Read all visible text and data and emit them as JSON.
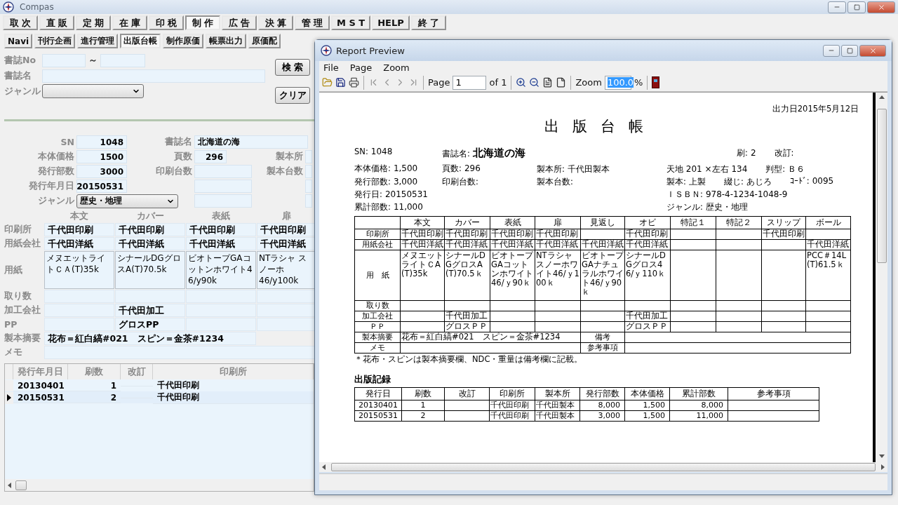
{
  "app": {
    "title": "Compas"
  },
  "main_menu": [
    {
      "label": "取 次",
      "selected": false
    },
    {
      "label": "直 販",
      "selected": false
    },
    {
      "label": "定 期",
      "selected": false
    },
    {
      "label": "在 庫",
      "selected": false
    },
    {
      "label": "印 税",
      "selected": false
    },
    {
      "label": "制 作",
      "selected": true
    },
    {
      "label": "広 告",
      "selected": false
    },
    {
      "label": "決 算",
      "selected": false
    },
    {
      "label": "管 理",
      "selected": false
    },
    {
      "label": "M S T",
      "selected": false
    },
    {
      "label": "HELP",
      "selected": false
    },
    {
      "label": "終 了",
      "selected": false
    }
  ],
  "tabs": [
    {
      "label": "Navi",
      "selected": false
    },
    {
      "label": "刊行企画",
      "selected": false
    },
    {
      "label": "進行管理",
      "selected": false
    },
    {
      "label": "出版台帳",
      "selected": true
    },
    {
      "label": "制作原価",
      "selected": false
    },
    {
      "label": "帳票出力",
      "selected": false
    },
    {
      "label": "原価配",
      "selected": false
    }
  ],
  "search": {
    "no_label": "書誌No",
    "range_separator": "～",
    "title_label": "書誌名",
    "genre_label": "ジャンル",
    "buttons": [
      "検 索",
      "クリア"
    ]
  },
  "details": [
    {
      "cells": [
        {
          "label": "SN",
          "value": "1048",
          "kind": "number"
        },
        {
          "label": "書誌名",
          "value": "北海道の海",
          "kind": "wide"
        }
      ]
    },
    {
      "cells": [
        {
          "label": "本体価格",
          "value": "1500",
          "kind": "number"
        },
        {
          "label": "頁数",
          "value": "296",
          "kind": "short"
        },
        {
          "label": "製本所",
          "kind": "stub"
        }
      ]
    },
    {
      "cells": [
        {
          "label": "発行部数",
          "value": "3000",
          "kind": "number"
        },
        {
          "label": "印刷台数",
          "kind": "field"
        },
        {
          "label": "製本台数",
          "kind": "stub"
        }
      ]
    },
    {
      "cells": [
        {
          "label": "発行年月日",
          "value": "20150531",
          "kind": "number"
        },
        {
          "kind": "field"
        },
        {
          "kind": "stub"
        }
      ]
    },
    {
      "cells": [
        {
          "label": "ジャンル",
          "value": "歴史・地理",
          "kind": "select"
        },
        {
          "kind": "field"
        },
        {
          "kind": "stub"
        }
      ]
    }
  ],
  "materials": {
    "columns": [
      "本文",
      "カバー",
      "表紙",
      "扉"
    ],
    "rows": [
      {
        "label": "印刷所",
        "kind": "line",
        "cells": [
          "千代田印刷",
          "千代田印刷",
          "千代田印刷",
          "千代田印刷"
        ]
      },
      {
        "label": "用紙会社",
        "kind": "line",
        "cells": [
          "千代田洋紙",
          "千代田洋紙",
          "千代田洋紙",
          "千代田洋紙"
        ]
      },
      {
        "label": "用紙",
        "kind": "tall",
        "cells": [
          "メヌエットライトＣＡ(T)35k",
          "シナールDGグロスA(T)70.5k",
          "ビオトープGAコットンホワイト46/y90k",
          "NTラシャ スノーホ\n46/y100k"
        ]
      },
      {
        "label": "取り数",
        "kind": "line",
        "cells": [
          "",
          "",
          "",
          ""
        ]
      },
      {
        "label": "加工会社",
        "kind": "line",
        "cells": [
          "",
          "千代田加工",
          "",
          ""
        ]
      },
      {
        "label": "PP",
        "kind": "line",
        "cells": [
          "",
          "グロスPP",
          "",
          ""
        ]
      }
    ],
    "binding_label": "製本摘要",
    "binding_value": "花布＝紅白縞#021　スピン＝金茶#1234",
    "memo_label": "メモ"
  },
  "history": {
    "columns": [
      "発行年月日",
      "刷数",
      "改訂",
      "印刷所"
    ],
    "rows": [
      {
        "date": "20130401",
        "printing": "1",
        "revision": "",
        "printer": "千代田印刷",
        "selected": false
      },
      {
        "date": "20150531",
        "printing": "2",
        "revision": "",
        "printer": "千代田印刷",
        "selected": true
      }
    ]
  },
  "report": {
    "title": "Report Preview",
    "menu": [
      "File",
      "Page",
      "Zoom"
    ],
    "toolbar": {
      "page_label": "Page",
      "page_value": "1",
      "page_of": "of 1",
      "zoom_label": "Zoom",
      "zoom_value": "100.0",
      "percent": "%"
    },
    "page": {
      "date": "出力日2015年5月12日",
      "heading": "出 版 台 帳",
      "info_rows": [
        {
          "left": [
            {
              "label": "SN:",
              "value": "1048"
            },
            {
              "label": "書誌名:",
              "value": "北海道の海",
              "kind": "big"
            }
          ],
          "right": [
            {
              "label": "刷:",
              "value": "2"
            },
            {
              "label": "改訂:"
            }
          ]
        },
        {
          "left": [
            {
              "label": "本体価格:",
              "value": "1,500"
            },
            {
              "label": "頁数:",
              "value": "296"
            },
            {
              "label": "製本所:",
              "value": "千代田製本"
            }
          ],
          "right": [
            {
              "value": "天地 201 ×左右 134"
            },
            {
              "label": "判型:",
              "value": "Ｂ６"
            }
          ]
        },
        {
          "left": [
            {
              "label": "発行部数:",
              "value": "3,000"
            },
            {
              "label": "印刷台数:"
            },
            {
              "label": "製本台数:"
            }
          ],
          "right": [
            {
              "label": "製本:",
              "value": "上製"
            },
            {
              "label": "綴じ:",
              "value": "あじろ"
            },
            {
              "label": "ｺｰﾄﾞ:",
              "value": "0095"
            }
          ]
        },
        {
          "left": [
            {
              "label": "発行日:",
              "value": "20150531"
            }
          ],
          "right": [
            {
              "label": "ＩＳＢＮ:",
              "value": "978-4-1234-1048-9"
            }
          ]
        },
        {
          "left": [
            {
              "label": "累計部数:",
              "value": "11,000"
            }
          ],
          "right": [
            {
              "label": "ジャンル:",
              "value": "歴史・地理"
            }
          ]
        }
      ],
      "table": {
        "columns": [
          "本文",
          "カバー",
          "表紙",
          "扉",
          "見返し",
          "オビ",
          "特記１",
          "特記２",
          "スリップ",
          "ボール"
        ],
        "rows": [
          {
            "label": "印刷所",
            "kind": "line",
            "cells": [
              "千代田印刷",
              "千代田印刷",
              "千代田印刷",
              "千代田印刷",
              "",
              "千代田印刷",
              "",
              "",
              "千代田印刷",
              ""
            ]
          },
          {
            "label": "用紙会社",
            "kind": "line",
            "cells": [
              "千代田洋紙",
              "千代田洋紙",
              "千代田洋紙",
              "千代田洋紙",
              "千代田洋紙",
              "千代田洋紙",
              "",
              "",
              "",
              "千代田洋紙"
            ]
          },
          {
            "label": "用　紙",
            "kind": "tall",
            "cells": [
              "メヌエットライトＣA(T)35k",
              "シナールDGグロスA(T)70.5ｋ",
              "ビオトープGAコットンホワイト46/ｙ90ｋ",
              "NTラシャスノーホワイト46/ｙ100ｋ",
              "ビオトープGAナチュラルホワイト46/ｙ90ｋ",
              "シナールDGグロス46/ｙ110ｋ",
              "",
              "",
              "",
              "PCC＃14L(T)61.5ｋ"
            ]
          },
          {
            "label": "取り数",
            "kind": "line",
            "cells": [
              "",
              "",
              "",
              "",
              "",
              "",
              "",
              "",
              "",
              ""
            ]
          },
          {
            "label": "加工会社",
            "kind": "line",
            "cells": [
              "",
              "千代田加工",
              "",
              "",
              "",
              "千代田加工",
              "",
              "",
              "",
              ""
            ]
          },
          {
            "label": "ＰＰ",
            "kind": "line",
            "cells": [
              "",
              "グロスＰＰ",
              "",
              "",
              "",
              "グロスＰＰ",
              "",
              "",
              "",
              ""
            ]
          }
        ],
        "footer_rows": [
          {
            "label": "製本摘要",
            "value": "花布＝紅白縞#021　スピン＝金茶#1234",
            "side_label": "備考"
          },
          {
            "label": "メモ",
            "side_label": "参考事項"
          }
        ]
      },
      "note": "＊花布・スピンは製本摘要欄、NDC・重量は備考欄に記載。",
      "record_heading": "出版記録",
      "record": {
        "columns": [
          "発行日",
          "刷数",
          "改訂",
          "印刷所",
          "製本所",
          "発行部数",
          "本体価格",
          "累計部数",
          "参考事項"
        ],
        "rows": [
          [
            "20130401",
            "1",
            "",
            "千代田印刷",
            "千代田製本",
            "8,000",
            "1,500",
            "8,000",
            ""
          ],
          [
            "20150531",
            "2",
            "",
            "千代田印刷",
            "千代田製本",
            "3,000",
            "1,500",
            "11,000",
            ""
          ]
        ]
      }
    }
  }
}
